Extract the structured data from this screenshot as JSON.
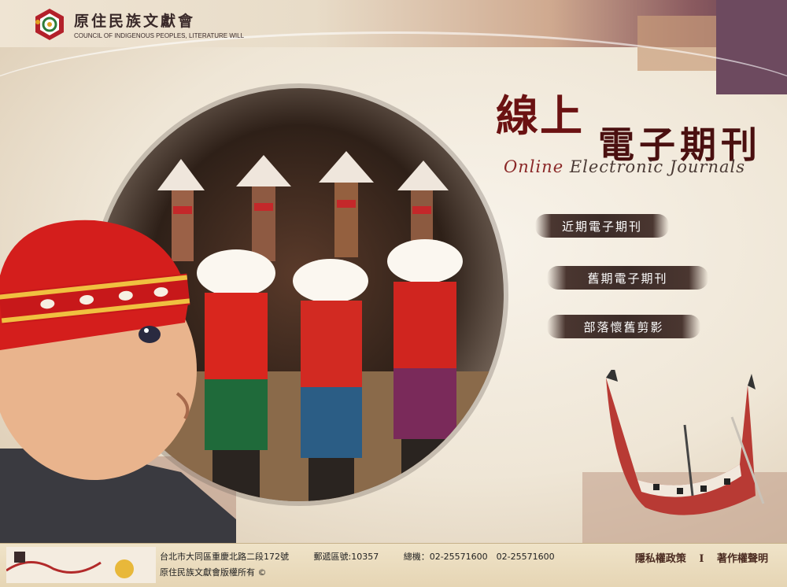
{
  "header": {
    "logo_cn": "原住民族文獻會",
    "logo_en": "COUNCIL OF INDIGENOUS PEOPLES, LITERATURE WILL"
  },
  "title": {
    "cn_part1": "線上",
    "cn_part2": "電子期刊",
    "en_first": "Online",
    "en_rest": " Electronic Journals"
  },
  "nav": {
    "items": [
      {
        "label": "近期電子期刊"
      },
      {
        "label": "舊期電子期刊"
      },
      {
        "label": "部落懷舊剪影"
      }
    ]
  },
  "footer": {
    "address": "台北市大同區重慶北路二段172號",
    "postal": "郵遞區號:10357",
    "phone": "總機：02-25571600　02-25571600",
    "copyright": "原住民族文獻會版權所有 ©",
    "privacy": "隱私權政策",
    "separator": "I",
    "copyright_notice": "著作權聲明"
  },
  "colors": {
    "title_red": "#6b1212",
    "nav_bg": "#3c2c28",
    "footer_bg": "#e6d5b4"
  }
}
